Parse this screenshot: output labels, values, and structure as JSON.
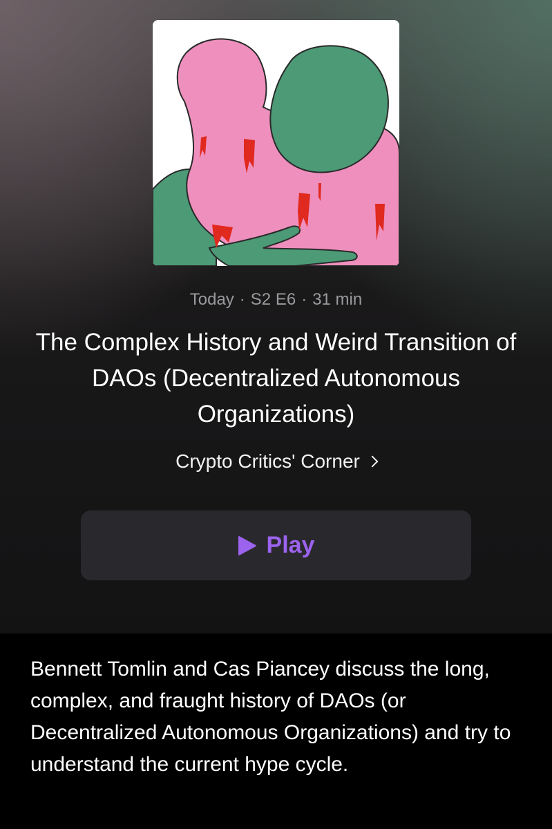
{
  "episode": {
    "artwork_icon": "podcast-artwork",
    "date": "Today",
    "season_episode": "S2 E6",
    "duration": "31 min",
    "separator": "·",
    "title": "The Complex History and Weird Transition of DAOs (Decentralized Autonomous Organizations)",
    "show_name": "Crypto Critics' Corner",
    "play_label": "Play",
    "description": "Bennett Tomlin and Cas Piancey discuss the long, complex, and fraught history of DAOs (or Decentralized Autonomous Organizations) and try to understand the current hype cycle."
  },
  "colors": {
    "accent": "#9b63ee",
    "artwork_pink": "#ef8fbd",
    "artwork_green": "#4c9a76",
    "artwork_red": "#e0291f"
  }
}
